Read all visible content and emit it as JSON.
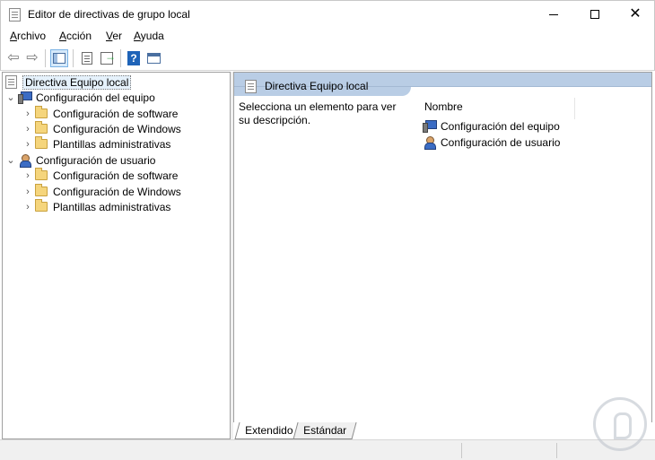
{
  "window": {
    "title": "Editor de directivas de grupo local",
    "close_glyph": "✕"
  },
  "menu": {
    "items": [
      {
        "mnemonic": "A",
        "rest": "rchivo"
      },
      {
        "mnemonic": "A",
        "rest": "cción"
      },
      {
        "mnemonic": "V",
        "rest": "er"
      },
      {
        "mnemonic": "A",
        "rest": "yuda"
      }
    ]
  },
  "toolbar": {
    "help_glyph": "?",
    "back_glyph": "⇦",
    "forward_glyph": "⇨"
  },
  "tree": {
    "root": "Directiva Equipo local",
    "expanded_chevron": "⌄",
    "collapsed_chevron": "›",
    "computer": {
      "label": "Configuración del equipo",
      "children": [
        "Configuración de software",
        "Configuración de Windows",
        "Plantillas administrativas"
      ]
    },
    "user": {
      "label": "Configuración de usuario",
      "children": [
        "Configuración de software",
        "Configuración de Windows",
        "Plantillas administrativas"
      ]
    }
  },
  "details": {
    "header_title": "Directiva Equipo local",
    "description": "Selecciona un elemento para ver su descripción.",
    "column_name": "Nombre",
    "items": [
      "Configuración del equipo",
      "Configuración de usuario"
    ]
  },
  "tabs": {
    "extended": "Extendido",
    "standard": "Estándar"
  },
  "icons": {
    "app": "policy-document-icon",
    "back": "back-arrow-icon",
    "forward": "forward-arrow-icon",
    "folder": "folder-icon",
    "computer": "computer-icon",
    "user": "user-icon",
    "help": "help-icon"
  }
}
